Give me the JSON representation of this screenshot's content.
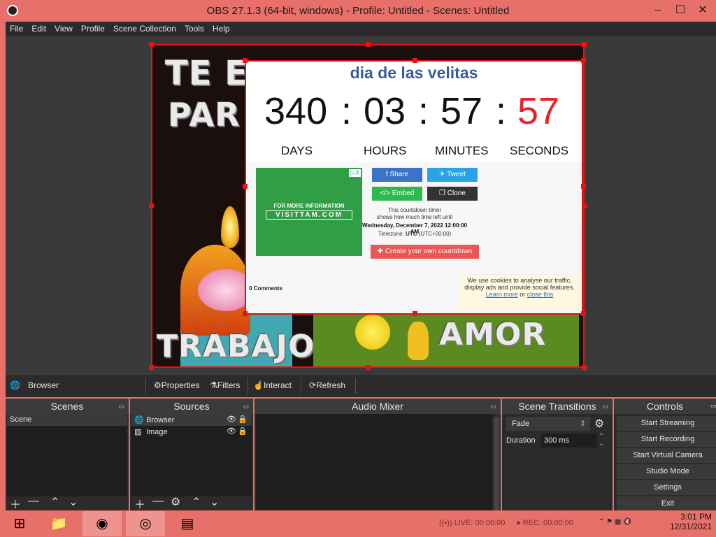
{
  "window": {
    "title": "OBS 27.1.3 (64-bit, windows) - Profile: Untitled - Scenes: Untitled",
    "minimize": "–",
    "maximize": "☐",
    "close": "✕"
  },
  "menu": [
    "File",
    "Edit",
    "View",
    "Profile",
    "Scene Collection",
    "Tools",
    "Help"
  ],
  "preview": {
    "bg_text": {
      "line1": "TE E",
      "line2": "PAR",
      "trabajo": "TRABAJO",
      "amor": "AMOR"
    },
    "browser": {
      "title": "dia de las velitas",
      "days": "340",
      "hours": "03",
      "minutes": "57",
      "seconds": "57",
      "sep": ":",
      "labels": {
        "days": "DAYS",
        "hours": "HOURS",
        "minutes": "MINUTES",
        "seconds": "SECONDS"
      },
      "ad": {
        "line1": "FOR MORE INFORMATION",
        "line2": "VISITTAM.COM",
        "close": "▷X"
      },
      "buttons": {
        "share": "Share",
        "tweet": "Tweet",
        "embed": "Embed",
        "clone": "Clone"
      },
      "info": {
        "line1": "This countdown timer",
        "line2": "shows how much time left until",
        "date": "Wednesday, December 7, 2022 12:00:00 AM",
        "timezone_label": "Timezone:",
        "timezone": "UTC",
        "timezone_offset": "(UTC+00:00)"
      },
      "create": "Create your own countdown",
      "comments": "0 Comments",
      "cookie": {
        "text": "We use cookies to analyse our traffic, display ads and provide social features.",
        "learn": "Learn more",
        "or": "or",
        "close": "close this"
      }
    }
  },
  "source_toolbar": {
    "source_name": "Browser",
    "properties": "Properties",
    "filters": "Filters",
    "interact": "Interact",
    "refresh": "Refresh"
  },
  "docks": {
    "scenes": {
      "title": "Scenes",
      "items": [
        "Scene"
      ]
    },
    "sources": {
      "title": "Sources",
      "items": [
        {
          "label": "Browser"
        },
        {
          "label": "Image"
        }
      ]
    },
    "audio_mixer": {
      "title": "Audio Mixer"
    },
    "transitions": {
      "title": "Scene Transitions",
      "selected": "Fade",
      "duration_label": "Duration",
      "duration_value": "300 ms"
    },
    "controls": {
      "title": "Controls",
      "buttons": [
        "Start Streaming",
        "Start Recording",
        "Start Virtual Camera",
        "Studio Mode",
        "Settings",
        "Exit"
      ]
    }
  },
  "status": {
    "live": "LIVE: 00:00:00",
    "rec": "REC: 00:00:00"
  },
  "taskbar": {
    "time": "3:01 PM",
    "date": "12/31/2021"
  },
  "colors": {
    "accent_title": "#3d5a9e",
    "seconds_red": "#e8212a",
    "taskbar": "#e8706a",
    "share_blue": "#3b73c7",
    "tweet_blue": "#2aa3e6",
    "embed_green": "#2eb84f",
    "clone_dark": "#333333"
  }
}
